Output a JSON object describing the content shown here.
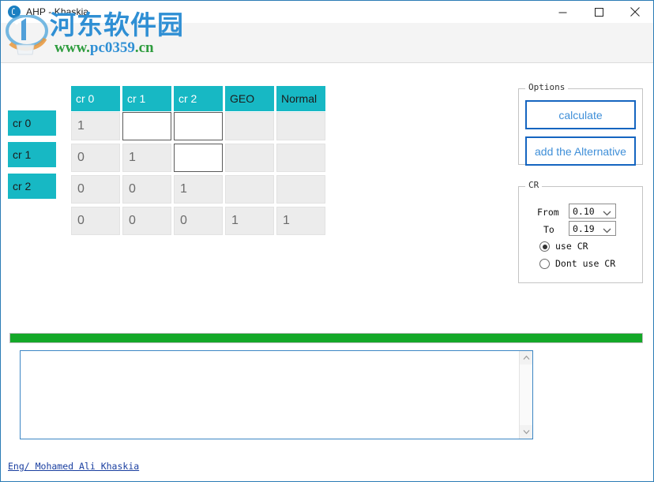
{
  "window": {
    "title": "AHP - Khaskia",
    "app_icon": "ahp-app-icon",
    "controls": {
      "minimize": "minimize-icon",
      "maximize": "maximize-icon",
      "close": "close-icon"
    }
  },
  "watermark": {
    "site_name": "河东软件园",
    "url_prefix": "www.",
    "url_highlight": "pc0359",
    "url_suffix": ".cn"
  },
  "matrix": {
    "column_headers": [
      "cr 0",
      "cr 1",
      "cr 2",
      "GEO",
      "Normal"
    ],
    "row_headers": [
      "cr 0",
      "cr 1",
      "cr 2",
      ""
    ],
    "rows": [
      [
        {
          "value": "1",
          "editable": false
        },
        {
          "value": "",
          "editable": true
        },
        {
          "value": "",
          "editable": true
        },
        {
          "value": "",
          "editable": false
        },
        {
          "value": "",
          "editable": false
        }
      ],
      [
        {
          "value": "0",
          "editable": false
        },
        {
          "value": "1",
          "editable": false
        },
        {
          "value": "",
          "editable": true
        },
        {
          "value": "",
          "editable": false
        },
        {
          "value": "",
          "editable": false
        }
      ],
      [
        {
          "value": "0",
          "editable": false
        },
        {
          "value": "0",
          "editable": false
        },
        {
          "value": "1",
          "editable": false
        },
        {
          "value": "",
          "editable": false
        },
        {
          "value": "",
          "editable": false
        }
      ],
      [
        {
          "value": "0",
          "editable": false
        },
        {
          "value": "0",
          "editable": false
        },
        {
          "value": "0",
          "editable": false
        },
        {
          "value": "1",
          "editable": false
        },
        {
          "value": "1",
          "editable": false
        }
      ]
    ]
  },
  "options_panel": {
    "title": "Options",
    "calculate_label": "calculate",
    "add_alternative_label": "add the Alternative"
  },
  "cr_panel": {
    "title": "CR",
    "from_label": "From",
    "from_value": "0.10",
    "to_label": "To",
    "to_value": "0.19",
    "use_cr_label": "use CR",
    "dont_use_cr_label": "Dont use CR",
    "selected": "use CR"
  },
  "progress": {
    "value": 100,
    "color": "#14a828"
  },
  "output": {
    "text": "",
    "placeholder": ""
  },
  "statusbar": {
    "author_link": "Eng/ Mohamed Ali Khaskia"
  },
  "colors": {
    "header_teal": "#17b8c4",
    "accent_blue": "#1565c0",
    "progress_green": "#14a828",
    "link_blue": "#1a3fa0"
  }
}
